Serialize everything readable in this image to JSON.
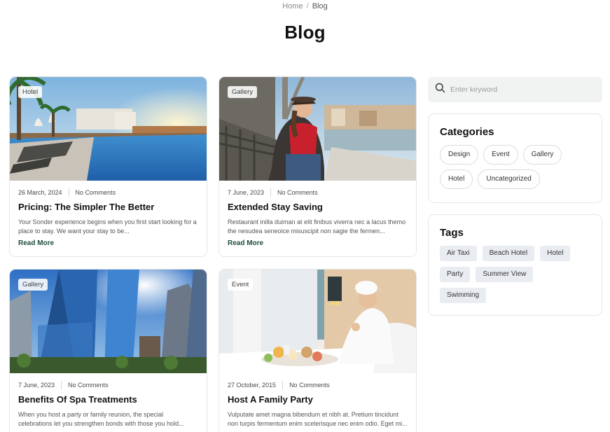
{
  "breadcrumb": {
    "home": "Home",
    "separator": "/",
    "current": "Blog"
  },
  "page": {
    "title": "Blog"
  },
  "posts": [
    {
      "badge": "Hotel",
      "date": "26 March, 2024",
      "comments": "No Comments",
      "title": "Pricing: The Simpler The Better",
      "excerpt": "Your Sonder experience begins when you first start looking for a place to stay. We want your stay to be...",
      "read_more": "Read More"
    },
    {
      "badge": "Gallery",
      "date": "7 June, 2023",
      "comments": "No Comments",
      "title": "Extended Stay Saving",
      "excerpt": "Restaurant inilla duiman at elit finibus viverra nec a lacus themo the nesudea seneoice misuscipit non sagie the fermen...",
      "read_more": "Read More"
    },
    {
      "badge": "Gallery",
      "date": "7 June, 2023",
      "comments": "No Comments",
      "title": "Benefits Of Spa Treatments",
      "excerpt": "When you host a party or family reunion, the special celebrations let you strengthen bonds with those you hold..."
    },
    {
      "badge": "Event",
      "date": "27 October, 2015",
      "comments": "No Comments",
      "title": "Host A Family Party",
      "excerpt": "Vulputate amet magna bibendum et nibh at. Pretium tincidunt non turpis fermentum enim scelerisque nec enim odio. Eget mi..."
    }
  ],
  "search": {
    "placeholder": "Enter keyword",
    "icon": "search-icon"
  },
  "categories": {
    "title": "Categories",
    "items": [
      "Design",
      "Event",
      "Gallery",
      "Hotel",
      "Uncategorized"
    ]
  },
  "tags": {
    "title": "Tags",
    "items": [
      "Air Taxi",
      "Beach Hotel",
      "Hotel",
      "Party",
      "Summer View",
      "Swimming"
    ]
  },
  "colors": {
    "accent": "#1e4d3b",
    "tag_bg": "#e9edf1",
    "search_bg": "#f1f3f2"
  }
}
